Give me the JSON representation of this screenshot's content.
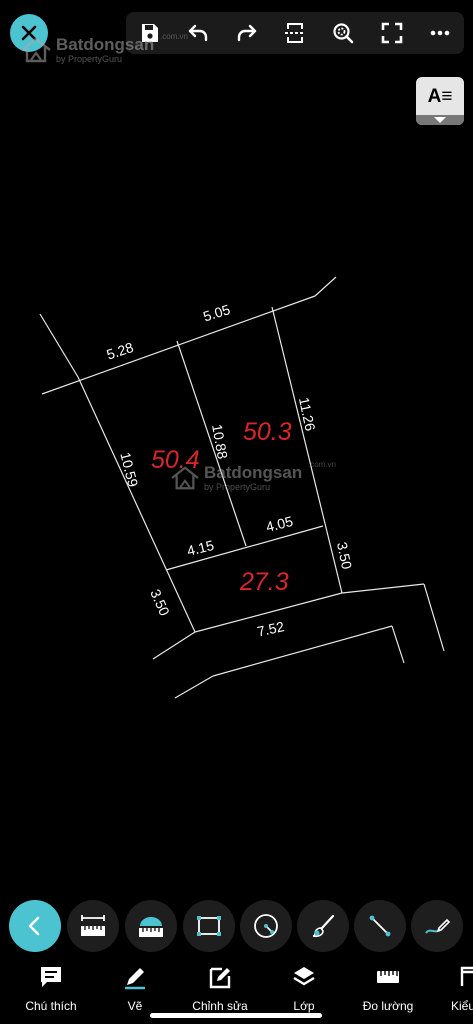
{
  "watermark": {
    "brand": "Batdongsan",
    "suffix": ".com.vn",
    "sub": "by PropertyGuru"
  },
  "text_style_button": {
    "label": "A≡"
  },
  "icons": {
    "close": "close-icon",
    "save": "save-icon",
    "undo": "undo-icon",
    "redo": "redo-icon",
    "fit": "fit-page-icon",
    "zoom": "zoom-icon",
    "fullscreen": "fullscreen-icon",
    "more": "more-icon"
  },
  "plot": {
    "dimensions": [
      "5.05",
      "5.28",
      "11.26",
      "10.88",
      "10.59",
      "4.15",
      "4.05",
      "3.50",
      "3.50",
      "7.52"
    ],
    "areas": [
      "50.3",
      "50.4",
      "27.3"
    ]
  },
  "tools": [
    {
      "name": "back",
      "icon": "chevron-left-icon"
    },
    {
      "name": "ruler-measure",
      "icon": "ruler-measure-icon"
    },
    {
      "name": "area-measure",
      "icon": "area-ruler-icon"
    },
    {
      "name": "rectangle",
      "icon": "rectangle-icon"
    },
    {
      "name": "circle",
      "icon": "circle-radius-icon"
    },
    {
      "name": "brush",
      "icon": "brush-icon"
    },
    {
      "name": "line",
      "icon": "line-icon"
    },
    {
      "name": "freehand",
      "icon": "pencil-curve-icon"
    }
  ],
  "bottom_nav": [
    {
      "label": "Chú thích",
      "icon": "comment-icon"
    },
    {
      "label": "Vẽ",
      "icon": "pencil-icon"
    },
    {
      "label": "Chỉnh sửa",
      "icon": "edit-icon"
    },
    {
      "label": "Lớp",
      "icon": "layers-icon"
    },
    {
      "label": "Đo lường",
      "icon": "ruler-icon"
    },
    {
      "label": "Kiểu",
      "icon": "style-icon"
    }
  ],
  "colors": {
    "accent": "#4bc3d1",
    "area_label": "#d8262a"
  }
}
